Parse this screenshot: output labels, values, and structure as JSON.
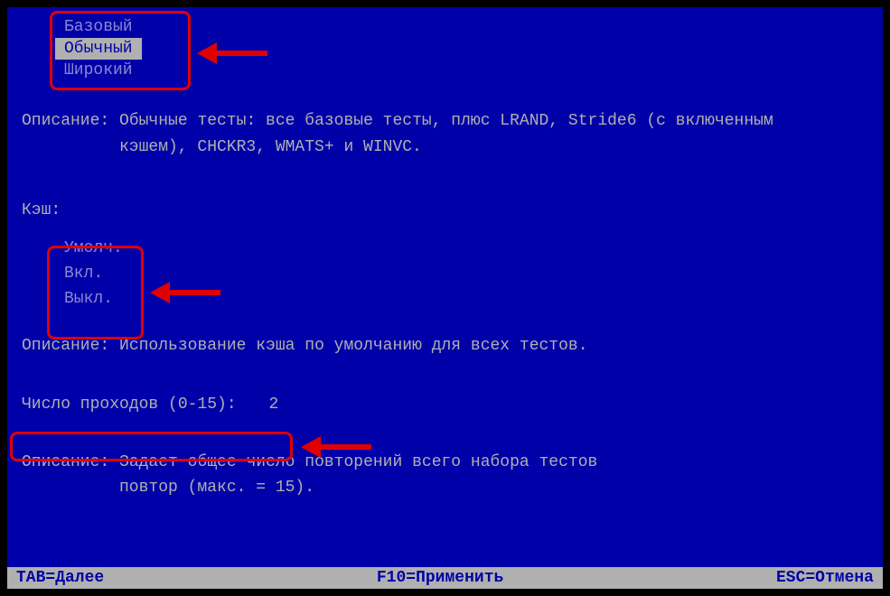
{
  "testMenu": {
    "items": [
      {
        "label": "Базовый"
      },
      {
        "label": "Обычный"
      },
      {
        "label": "Широкий"
      }
    ]
  },
  "descriptions": {
    "label": "Описание:",
    "test": "Обычные тесты: все базовые тесты, плюс LRAND, Stride6 (с включенным",
    "testCont": "кэшем), CHCKR3, WMATS+ и WINVC.",
    "cache": "Использование кэша по умолчанию для всех тестов.",
    "passes": "Задает общее число повторений всего набора тестов",
    "passesCont": "повтор (макс. = 15)."
  },
  "cache": {
    "label": "Кэш:",
    "items": [
      {
        "label": "Умолч."
      },
      {
        "label": "Вкл."
      },
      {
        "label": "Выкл."
      }
    ]
  },
  "passes": {
    "label": "Число проходов (0-15):",
    "value": "2"
  },
  "footer": {
    "tab": "TAB=Далее",
    "f10": "F10=Применить",
    "esc": "ESC=Отмена"
  }
}
